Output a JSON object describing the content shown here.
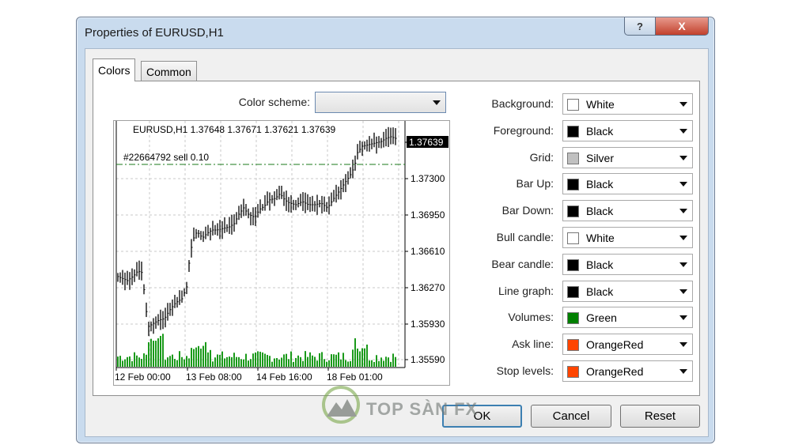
{
  "window": {
    "title": "Properties of EURUSD,H1",
    "help_label": "?",
    "close_label": "X"
  },
  "tabs": [
    {
      "label": "Colors",
      "active": true
    },
    {
      "label": "Common",
      "active": false
    }
  ],
  "color_scheme": {
    "label": "Color scheme:",
    "value": ""
  },
  "chart_preview": {
    "header": "EURUSD,H1  1.37648 1.37671 1.37621 1.37639",
    "order_label": "#22664792 sell 0.10",
    "current_price": "1.37639",
    "y_ticks": [
      "1.37300",
      "1.36950",
      "1.36610",
      "1.36270",
      "1.35930",
      "1.35590"
    ],
    "x_ticks": [
      "12 Feb 00:00",
      "13 Feb 08:00",
      "14 Feb 16:00",
      "18 Feb 01:00"
    ]
  },
  "color_settings": [
    {
      "label": "Background:",
      "value": "White",
      "color": "#ffffff"
    },
    {
      "label": "Foreground:",
      "value": "Black",
      "color": "#000000"
    },
    {
      "label": "Grid:",
      "value": "Silver",
      "color": "#c0c0c0"
    },
    {
      "label": "Bar Up:",
      "value": "Black",
      "color": "#000000"
    },
    {
      "label": "Bar Down:",
      "value": "Black",
      "color": "#000000"
    },
    {
      "label": "Bull candle:",
      "value": "White",
      "color": "#ffffff"
    },
    {
      "label": "Bear candle:",
      "value": "Black",
      "color": "#000000"
    },
    {
      "label": "Line graph:",
      "value": "Black",
      "color": "#000000"
    },
    {
      "label": "Volumes:",
      "value": "Green",
      "color": "#008000"
    },
    {
      "label": "Ask line:",
      "value": "OrangeRed",
      "color": "#ff4500"
    },
    {
      "label": "Stop levels:",
      "value": "OrangeRed",
      "color": "#ff4500"
    }
  ],
  "buttons": {
    "ok": "OK",
    "cancel": "Cancel",
    "reset": "Reset"
  },
  "watermark": {
    "text": "TOP SÀN FX"
  }
}
